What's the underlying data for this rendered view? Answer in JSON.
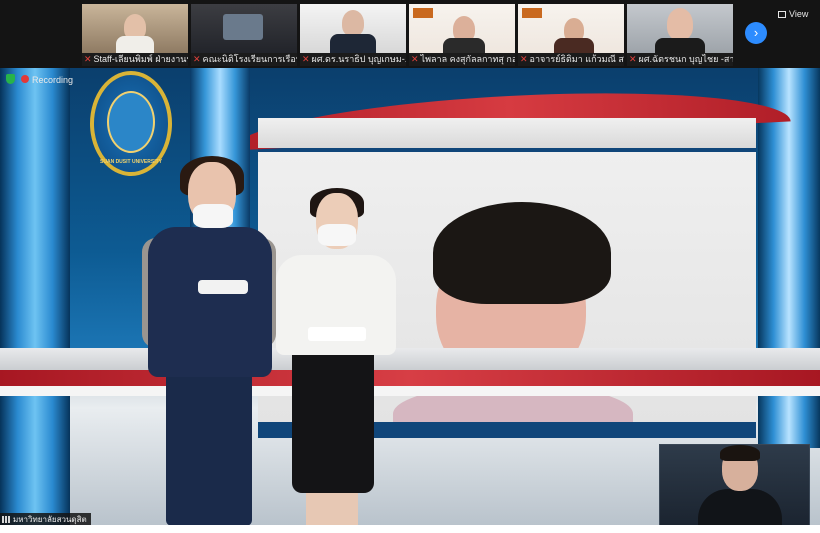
{
  "window": {
    "view_label": "View",
    "recording_label": "Recording"
  },
  "participants": [
    {
      "name": "Staff-เลียนพิมพ์ ฝ่ายงานฯ"
    },
    {
      "name": "คณะนิติโรงเรียนการเรือน"
    },
    {
      "name": "ผศ.ดร.นราธิป บุญเกษม-..."
    },
    {
      "name": "ไพลาล คงสุกัลลกาทสุ กอ..."
    },
    {
      "name": "อาจารย์ธิติมา แก้วมณี สา..."
    },
    {
      "name": "ผศ.ฉัตรชนก บุญไชย -สาขา..."
    }
  ],
  "main_video": {
    "logo_text": "SUAN DUSIT UNIVERSITY",
    "host_name": "มหาวิทยาลัยสวนดุสิต"
  },
  "colors": {
    "accent": "#2d8cff",
    "recording": "#e23838",
    "secure": "#27b34a"
  },
  "icons": {
    "next": "chevron-right-icon",
    "view": "grid-view-icon",
    "muted": "mic-muted-icon"
  }
}
